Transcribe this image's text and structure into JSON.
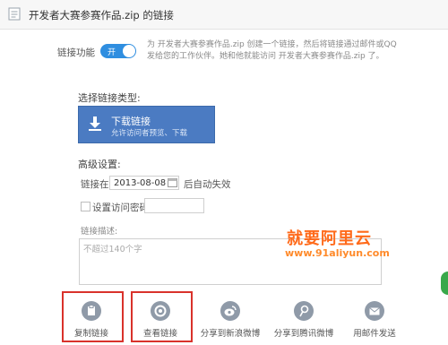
{
  "dialog": {
    "title": "开发者大赛参赛作品.zip 的链接"
  },
  "link_toggle": {
    "label": "链接功能",
    "state_text": "开",
    "description": "为 开发者大赛参赛作品.zip 创建一个链接，然后将链接通过邮件或QQ发给您的工作伙伴。她和他就能访问 开发者大赛参赛作品.zip 了。"
  },
  "link_type": {
    "section_label": "选择链接类型:",
    "option_title": "下载链接",
    "option_sub": "允许访问者预览、下载"
  },
  "advanced": {
    "section_label": "高级设置:",
    "expire_prefix": "链接在",
    "expire_date": "2013-08-08",
    "expire_suffix": "后自动失效",
    "password_label": "设置访问密码"
  },
  "description_box": {
    "label": "链接描述:",
    "placeholder": "不超过140个字"
  },
  "actions": [
    {
      "label": "复制链接",
      "icon": "clipboard-icon"
    },
    {
      "label": "查看链接",
      "icon": "view-link-icon"
    },
    {
      "label": "分享到新浪微博",
      "icon": "weibo-icon"
    },
    {
      "label": "分享到腾讯微博",
      "icon": "tencent-weibo-icon"
    },
    {
      "label": "用邮件发送",
      "icon": "mail-icon"
    }
  ],
  "watermark": {
    "text": "就要阿里云",
    "url": "www.91aliyun.com"
  },
  "colors": {
    "accent": "#2f8ee0",
    "card": "#4b7bc2",
    "highlight": "#d9322b",
    "watermark": "#ff6a1a"
  }
}
